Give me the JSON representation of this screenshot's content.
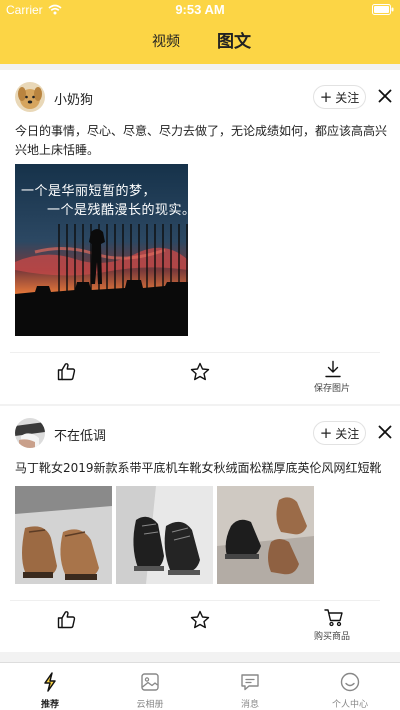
{
  "status_bar": {
    "carrier": "Carrier",
    "time": "9:53 AM"
  },
  "top_tabs": {
    "video": "视频",
    "article": "图文"
  },
  "posts": [
    {
      "username": "小奶狗",
      "follow_label": "关注",
      "text": "今日的事情，尽心、尽意、尽力去做了，无论成绩如何，都应该高高兴兴地上床恬睡。",
      "image_caption_line1": "一个是华丽短暂的梦，",
      "image_caption_line2": "一个是残酷漫长的现实。",
      "actions": {
        "like_icon": "thumbs-up-icon",
        "favorite_icon": "star-icon",
        "save_label": "保存图片"
      }
    },
    {
      "username": "不在低调",
      "follow_label": "关注",
      "text": "马丁靴女2019新款系带平底机车靴女秋绒面松糕厚底英伦风网红短靴",
      "actions": {
        "like_icon": "thumbs-up-icon",
        "favorite_icon": "star-icon",
        "buy_label": "购买商品"
      }
    }
  ],
  "tabbar": {
    "items": [
      {
        "label": "推荐",
        "icon": "lightning-icon",
        "active": true
      },
      {
        "label": "云相册",
        "icon": "photo-album-icon",
        "active": false
      },
      {
        "label": "消息",
        "icon": "message-icon",
        "active": false
      },
      {
        "label": "个人中心",
        "icon": "smiley-icon",
        "active": false
      }
    ]
  },
  "colors": {
    "header": "#fcd545",
    "background": "#f2f2f2",
    "card": "#ffffff",
    "text": "#222222",
    "muted": "#888888"
  }
}
